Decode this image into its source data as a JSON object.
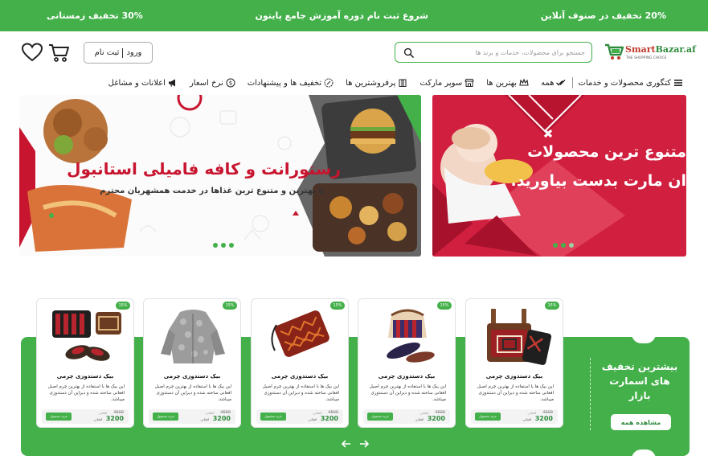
{
  "topbar": {
    "left": "30% تخفیف زمستانی",
    "center": "شروع ثبت نام دوره آموزش جامع پایتون",
    "right": "20% تخفیف در صنوف آنلاین"
  },
  "header": {
    "logo_brand_a": "Smart",
    "logo_brand_b": "Bazar.af",
    "logo_tagline": "THE SHOPPING CHOICE",
    "search_placeholder": "جستجو برای محصولات، خدمات و برند ها",
    "login": "ورود",
    "register": "ثبت نام"
  },
  "nav": {
    "category": "کتگوری محصولات و خدمات",
    "items": [
      "همه",
      "بهترین ها",
      "سوپر مارکت",
      "پرفروشترین ها",
      "تخفیف ها و پیشنهادات",
      "نرخ اسعار",
      "اعلانات و مشاغل"
    ]
  },
  "banners": {
    "left_title": "رستورانت و کافه فامیلی استانبول",
    "left_sub": "با بهترین و متنوع ترین غذاها در خدمت همشهریان محترم",
    "right_line1": "متنوع ترین محصولات",
    "right_line2": "ان مارت بدست بیاورید."
  },
  "deals": {
    "title": "بیشترین تخفیف های اسمارت بازار",
    "see_all": "مشاهده همه",
    "products": [
      {
        "badge": "15%",
        "name": "بیک دستدوزی چرمی",
        "desc": "این بیک ها با استفاده از بهترین چرم اصیل افغانی ساخته شده و دیزاین آن دستدوزی میباشد.",
        "old_label": "افغانی",
        "old_price": "4500",
        "price_label": "افغانی",
        "price": "3200",
        "buy": "خرید محصول",
        "image": "bag-icon"
      },
      {
        "badge": "15%",
        "name": "بیک دستدوزی چرمی",
        "desc": "این بیک ها با استفاده از بهترین چرم اصیل افغانی ساخته شده و دیزاین آن دستدوزی میباشد.",
        "old_label": "افغانی",
        "old_price": "4500",
        "price_label": "افغانی",
        "price": "3200",
        "buy": "خرید محصول",
        "image": "shoes-bag-icon"
      },
      {
        "badge": "15%",
        "name": "بیک دستدوزی چرمی",
        "desc": "این بیک ها با استفاده از بهترین چرم اصیل افغانی ساخته شده و دیزاین آن دستدوزی میباشد.",
        "old_label": "افغانی",
        "old_price": "4500",
        "price_label": "افغانی",
        "price": "3200",
        "buy": "خرید محصول",
        "image": "clutch-icon"
      },
      {
        "badge": "15%",
        "name": "بیک دستدوزی چرمی",
        "desc": "این بیک ها با استفاده از بهترین چرم اصیل افغانی ساخته شده و دیزاین آن دستدوزی میباشد.",
        "old_label": "افغانی",
        "old_price": "4500",
        "price_label": "افغانی",
        "price": "3200",
        "buy": "خرید محصول",
        "image": "fur-coat-icon"
      },
      {
        "badge": "15%",
        "name": "بیک دستدوزی چرمی",
        "desc": "این بیک ها با استفاده از بهترین چرم اصیل افغانی ساخته شده و دیزاین آن دستدوزی میباشد.",
        "old_label": "افغانی",
        "old_price": "4500",
        "price_label": "افغانی",
        "price": "3200",
        "buy": "خرید محصول",
        "image": "shoes-clutch-icon"
      }
    ]
  },
  "colors": {
    "brand_green": "#43b04a",
    "banner_red": "#d11f3f",
    "title_red": "#c8152f"
  }
}
